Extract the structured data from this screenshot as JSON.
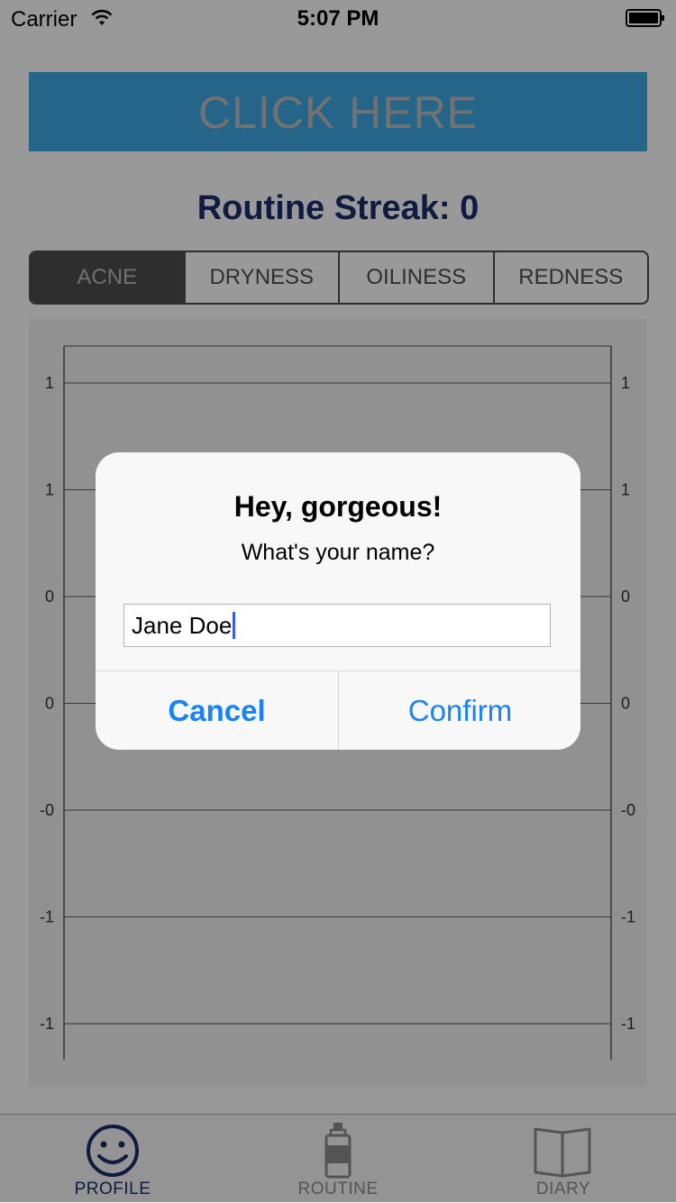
{
  "status_bar": {
    "carrier": "Carrier",
    "time": "5:07 PM",
    "icons": [
      "wifi-icon",
      "battery-icon"
    ]
  },
  "cta": {
    "label": "CLICK HERE",
    "color": "#3fa9e6"
  },
  "streak": {
    "text": "Routine Streak: 0"
  },
  "segments": {
    "items": [
      "ACNE",
      "DRYNESS",
      "OILINESS",
      "REDNESS"
    ],
    "selected": "ACNE"
  },
  "chart_data": {
    "type": "line",
    "series": [],
    "y_tick_labels": [
      "1",
      "1",
      "0",
      "0",
      "-0",
      "-1",
      "-1"
    ],
    "grid": true,
    "axes": [
      "left",
      "right"
    ]
  },
  "dialog": {
    "title": "Hey, gorgeous!",
    "message": "What's your name?",
    "input_value": "Jane Doe",
    "cancel_label": "Cancel",
    "confirm_label": "Confirm"
  },
  "tabbar": {
    "items": [
      {
        "label": "PROFILE",
        "icon": "smiley-icon",
        "active": true
      },
      {
        "label": "ROUTINE",
        "icon": "bottle-icon",
        "active": false
      },
      {
        "label": "DIARY",
        "icon": "book-icon",
        "active": false
      }
    ],
    "active_color": "#1a2d6b",
    "inactive_color": "#8c8c8c"
  }
}
